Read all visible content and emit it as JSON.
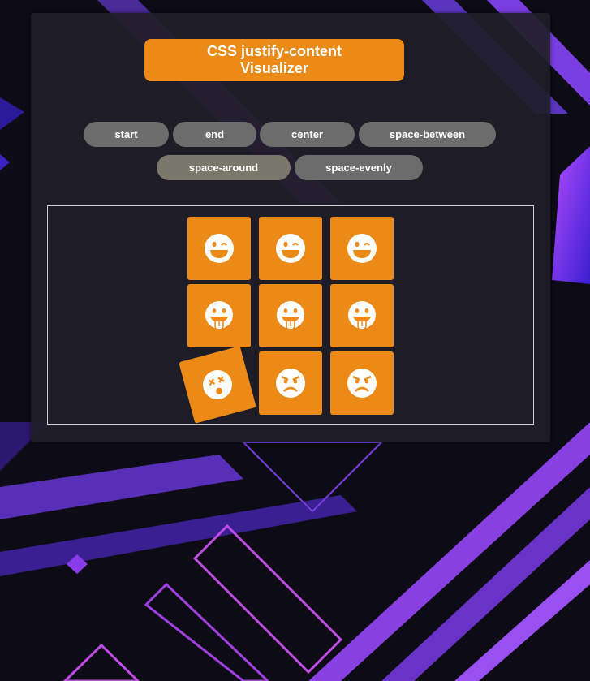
{
  "title": "CSS justify-content Visualizer",
  "buttons": [
    {
      "label": "start",
      "name": "start"
    },
    {
      "label": "end",
      "name": "end"
    },
    {
      "label": "center",
      "name": "center"
    },
    {
      "label": "space-between",
      "name": "space-between"
    },
    {
      "label": "space-around",
      "name": "space-around",
      "active": true
    },
    {
      "label": "space-evenly",
      "name": "space-evenly"
    }
  ],
  "tiles": [
    {
      "icon": "grin-wink-icon"
    },
    {
      "icon": "grin-wink-icon"
    },
    {
      "icon": "grin-wink-icon"
    },
    {
      "icon": "grin-tongue-icon"
    },
    {
      "icon": "grin-tongue-icon"
    },
    {
      "icon": "grin-tongue-icon"
    },
    {
      "icon": "dizzy-face-icon"
    },
    {
      "icon": "angry-face-icon"
    },
    {
      "icon": "angry-face-icon"
    }
  ],
  "colors": {
    "accent": "#ec8a17",
    "button": "#6c6c6c",
    "button_active": "#79786a",
    "panel": "#201e28",
    "background": "#0d0b16"
  }
}
